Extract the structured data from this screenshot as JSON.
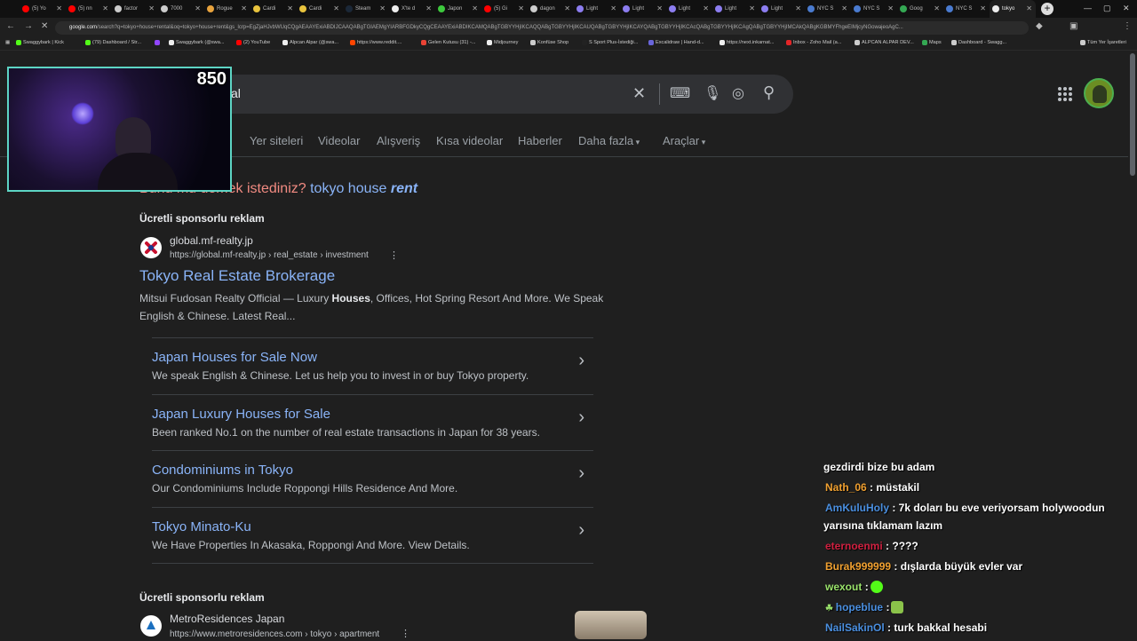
{
  "tabs": [
    {
      "label": "(5) Yo",
      "color": "#ff0000"
    },
    {
      "label": "(5) nn",
      "color": "#ff0000"
    },
    {
      "label": "factor",
      "color": "#cccccc"
    },
    {
      "label": "7000",
      "color": "#cccccc"
    },
    {
      "label": "Rogue",
      "color": "#e8a33d"
    },
    {
      "label": "Cardi",
      "color": "#e8c33d"
    },
    {
      "label": "Cardi",
      "color": "#e8c33d"
    },
    {
      "label": "Steam",
      "color": "#1b2838"
    },
    {
      "label": "X'te d",
      "color": "#eeeeee"
    },
    {
      "label": "Japon",
      "color": "#3dc93d"
    },
    {
      "label": "(5) Gi",
      "color": "#ff0000"
    },
    {
      "label": "dagon",
      "color": "#cccccc"
    },
    {
      "label": "Light",
      "color": "#8c7df0"
    },
    {
      "label": "Light",
      "color": "#8c7df0"
    },
    {
      "label": "Light",
      "color": "#8c7df0"
    },
    {
      "label": "Light",
      "color": "#8c7df0"
    },
    {
      "label": "Light",
      "color": "#8c7df0"
    },
    {
      "label": "NYC S",
      "color": "#4a7bd0"
    },
    {
      "label": "NYC S",
      "color": "#4a7bd0"
    },
    {
      "label": "Goog",
      "color": "#34a853"
    },
    {
      "label": "NYC S",
      "color": "#4a7bd0"
    },
    {
      "label": "tokyo",
      "color": "#eeeeee"
    }
  ],
  "address": {
    "host": "google.com",
    "rest": "/search?q=tokyo+house+rental&oq=tokyo+house+rent&gs_lcrp=EgZjaHJvbWUqCQgAEAAYExiABDIJCAAQABgTGIAEMgYIARBFGDkyCQgCEAAYExiABDIKCAMQABgTGBYYHjIKCAQQABgTGBYYHjIKCAUQABgTGBYYHjIKCAYQABgTGBYYHjIKCAcQABgTGBYYHjIKCAgQABgTGBYYHjIMCAkQABgKGBMYFhgeEIMjcyNGowajeoAgC..."
  },
  "bookmarks": [
    {
      "label": "Swaggybark | Kick",
      "color": "#53fc18"
    },
    {
      "label": "(79) Dashboard / Str...",
      "color": "#53fc18"
    },
    {
      "label": "",
      "color": "#9146ff"
    },
    {
      "label": "Swaggybark (@swa...",
      "color": "#eeeeee"
    },
    {
      "label": "(2) YouTube",
      "color": "#ff0000"
    },
    {
      "label": "Alpcan Alpar (@swa...",
      "color": "#eeeeee"
    },
    {
      "label": "https://www.reddit....",
      "color": "#ff4500"
    },
    {
      "label": "Gelen Kutusu (31) -...",
      "color": "#ea4335"
    },
    {
      "label": "Midjourney",
      "color": "#eeeeee"
    },
    {
      "label": "Konfüse Shop",
      "color": "#cccccc"
    },
    {
      "label": "S Sport Plus-İstediği...",
      "color": "#222222"
    },
    {
      "label": "Excalidraw | Hand-d...",
      "color": "#6965db"
    },
    {
      "label": "https://next.inkarnat...",
      "color": "#eeeeee"
    },
    {
      "label": "Inbox - Zoho Mail (a...",
      "color": "#e42527"
    },
    {
      "label": "ALPCAN ALPAR DEV...",
      "color": "#cccccc"
    },
    {
      "label": "Maps",
      "color": "#34a853"
    },
    {
      "label": "Dashboard - Swagg...",
      "color": "#cccccc"
    },
    {
      "label": "Tüm Yer İşaretleri",
      "color": "#cccccc"
    }
  ],
  "search": {
    "query": "al"
  },
  "filters": [
    "Yer siteleri",
    "Videolar",
    "Alışveriş",
    "Kısa videolar",
    "Haberler",
    "Daha fazla",
    "Araçlar"
  ],
  "did_you_mean": {
    "label": "Bunu mu demek istediniz?",
    "suggestion_plain": "tokyo house",
    "suggestion_emph": "rent"
  },
  "ad1": {
    "sponsor": "Ücretli sponsorlu reklam",
    "site": "global.mf-realty.jp",
    "url": "https://global.mf-realty.jp › real_estate › investment",
    "title": "Tokyo Real Estate Brokerage",
    "desc_pre": "Mitsui Fudosan Realty Official — Luxury ",
    "desc_bold": "Houses",
    "desc_post": ", Offices, Hot Spring Resort And More. We Speak English & Chinese. Latest Real..."
  },
  "sitelinks": [
    {
      "title": "Japan Houses for Sale Now",
      "desc": "We speak English & Chinese. Let us help you to invest in or buy Tokyo property."
    },
    {
      "title": "Japan Luxury Houses for Sale",
      "desc": "Been ranked No.1 on the number of real estate transactions in Japan for 38 years."
    },
    {
      "title": "Condominiums in Tokyo",
      "desc": "Our Condominiums Include Roppongi Hills Residence And More."
    },
    {
      "title": "Tokyo Minato-Ku",
      "desc": "We Have Properties In Akasaka, Roppongi And More. View Details."
    }
  ],
  "ad2": {
    "sponsor": "Ücretli sponsorlu reklam",
    "site": "MetroResidences Japan",
    "url": "https://www.metroresidences.com › tokyo › apartment"
  },
  "stream": {
    "viewers": "850"
  },
  "chat": [
    {
      "user": "",
      "user_color": "#ffffff",
      "text": "gezdirdi bize bu adam"
    },
    {
      "user": "Nath_06",
      "user_color": "#f0a030",
      "text": ": müstakil"
    },
    {
      "user": "AmKuluHoly",
      "user_color": "#4a8fe0",
      "text": ": 7k doları bu eve veriyorsam holywoodun"
    },
    {
      "user": "",
      "user_color": "#ffffff",
      "text": "yarısına tıklamam lazım"
    },
    {
      "user": "eternoenmi",
      "user_color": "#d02040",
      "text": ": ????"
    },
    {
      "user": "Burak999999",
      "user_color": "#f0a030",
      "text": ": dışlarda büyük evler var"
    },
    {
      "user": "wexout",
      "user_color": "#9ae36b",
      "text": ":"
    },
    {
      "user": "hopeblue",
      "user_color": "#4a8fe0",
      "text": ":"
    },
    {
      "user": "NailSakinOl",
      "user_color": "#4a8fe0",
      "text": ": turk bakkal hesabi"
    }
  ]
}
